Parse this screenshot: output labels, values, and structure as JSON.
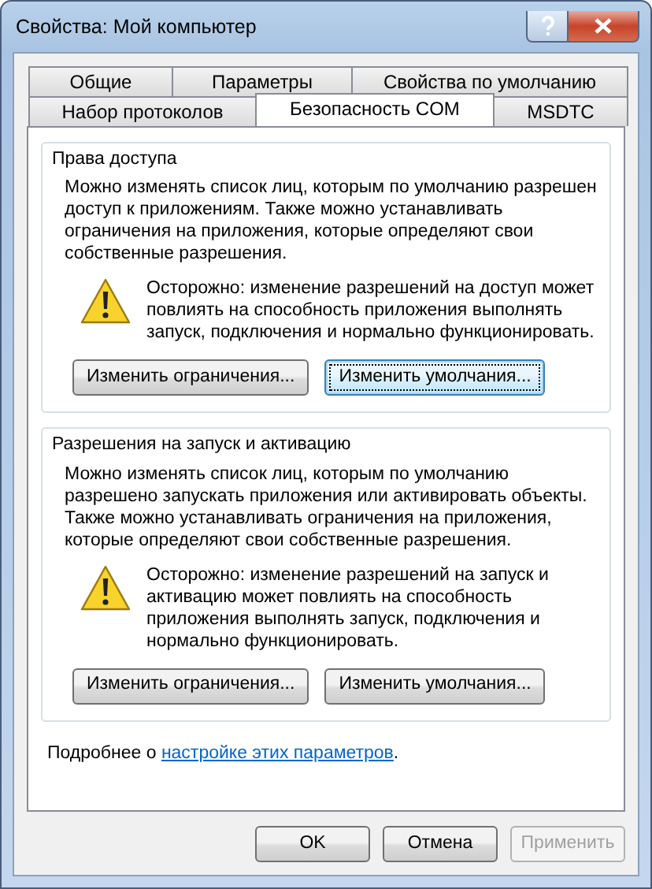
{
  "window": {
    "title": "Свойства: Мой компьютер"
  },
  "tab_rows": [
    [
      {
        "label": "Общие",
        "selected": false
      },
      {
        "label": "Параметры",
        "selected": false
      },
      {
        "label": "Свойства по умолчанию",
        "selected": false
      }
    ],
    [
      {
        "label": "Набор протоколов",
        "selected": false
      },
      {
        "label": "Безопасность COM",
        "selected": true
      },
      {
        "label": "MSDTC",
        "selected": false
      }
    ]
  ],
  "groups": [
    {
      "title": "Права доступа",
      "description": "Можно изменять список лиц, которым по умолчанию разрешен доступ к приложениям. Также можно устанавливать ограничения на приложения, которые определяют свои собственные разрешения.",
      "warning": "Осторожно: изменение разрешений на доступ может повлиять на способность приложения выполнять запуск, подключения и нормально функционировать.",
      "buttons": [
        {
          "label": "Изменить ограничения...",
          "focused": false
        },
        {
          "label": "Изменить умолчания...",
          "focused": true
        }
      ]
    },
    {
      "title": "Разрешения на запуск и активацию",
      "description": "Можно изменять список лиц, которым по умолчанию разрешено запускать приложения или активировать объекты. Также можно устанавливать ограничения на приложения, которые определяют свои собственные разрешения.",
      "warning": "Осторожно: изменение разрешений на запуск и активацию может повлиять на способность приложения выполнять запуск, подключения и нормально функционировать.",
      "buttons": [
        {
          "label": "Изменить ограничения...",
          "focused": false
        },
        {
          "label": "Изменить умолчания...",
          "focused": false
        }
      ]
    }
  ],
  "help": {
    "text": "Подробнее о ",
    "link": "настройке этих параметров",
    "end": "."
  },
  "dialog_buttons": [
    {
      "label": "OK",
      "disabled": false
    },
    {
      "label": "Отмена",
      "disabled": false
    },
    {
      "label": "Применить",
      "disabled": true
    }
  ]
}
